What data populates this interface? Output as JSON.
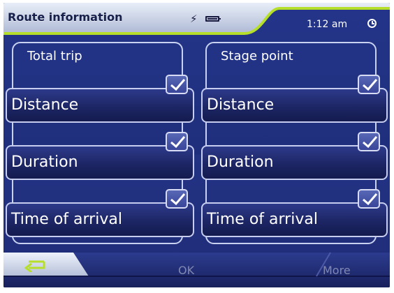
{
  "header": {
    "title": "Route information",
    "time": "1:12 am"
  },
  "icons": {
    "charge": "lightning-icon",
    "battery": "battery-icon",
    "clock": "clock-icon",
    "back": "back-arrow-icon",
    "check": "checkmark-icon"
  },
  "colors": {
    "background": "#23307a",
    "header": "#c7d1e6",
    "accent_green": "#b6df2c",
    "button_border": "#c6cdef"
  },
  "groups": [
    {
      "title": "Total trip",
      "options": [
        {
          "label": "Distance",
          "checked": true
        },
        {
          "label": "Duration",
          "checked": true
        },
        {
          "label": "Time of arrival",
          "checked": true
        }
      ]
    },
    {
      "title": "Stage point",
      "options": [
        {
          "label": "Distance",
          "checked": true
        },
        {
          "label": "Duration",
          "checked": true
        },
        {
          "label": "Time of arrival",
          "checked": true
        }
      ]
    }
  ],
  "footer": {
    "ok_label": "OK",
    "more_label": "More"
  }
}
